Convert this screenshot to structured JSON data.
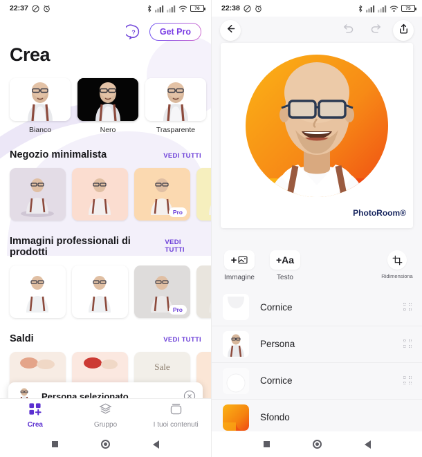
{
  "left": {
    "status": {
      "time": "22:37",
      "battery": "76",
      "icons": [
        "dnd-icon",
        "alarm-icon",
        "bluetooth-icon",
        "signal-icon",
        "signal-icon-2",
        "wifi-icon"
      ]
    },
    "top": {
      "help_label": "?",
      "get_pro_label": "Get Pro"
    },
    "title": "Crea",
    "backgrounds": [
      {
        "label": "Bianco",
        "style": "white"
      },
      {
        "label": "Nero",
        "style": "black"
      },
      {
        "label": "Trasparente",
        "style": "transparent"
      }
    ],
    "sections": [
      {
        "title": "Negozio minimalista",
        "see_all": "VEDI TUTTI",
        "tiles": [
          {
            "bg": "#e3dce6",
            "pro": false
          },
          {
            "bg": "#fbddd0",
            "pro": false
          },
          {
            "bg": "#fbd9b0",
            "pro": true,
            "pro_label": "Pro"
          },
          {
            "bg": "#f6efbe",
            "pro": false
          }
        ]
      },
      {
        "title": "Immagini professionali di prodotti",
        "see_all": "VEDI TUTTI",
        "tiles": [
          {
            "bg": "#ffffff",
            "pro": false
          },
          {
            "bg": "#ffffff",
            "pro": false
          },
          {
            "bg": "#dedcdb",
            "pro": true,
            "pro_label": "Pro"
          },
          {
            "bg": "#e9e5de",
            "pro": false
          }
        ]
      },
      {
        "title": "Saldi",
        "see_all": "VEDI TUTTI",
        "tiles": [
          {
            "bg": "#f7ece4",
            "pro": false
          },
          {
            "bg": "#fbe8e0",
            "pro": false
          },
          {
            "bg": "#f2efe9",
            "pro": false,
            "text": "Sale"
          },
          {
            "bg": "#fbe6d6",
            "pro": false
          }
        ]
      }
    ],
    "toast": {
      "text": "Persona selezionato",
      "close_icon": "close-circle-icon"
    },
    "nav": [
      {
        "label": "Crea",
        "icon": "grid-plus-icon",
        "active": true
      },
      {
        "label": "Gruppo",
        "icon": "layers-icon",
        "active": false
      },
      {
        "label": "I tuoi contenuti",
        "icon": "archive-icon",
        "active": false
      }
    ]
  },
  "right": {
    "status": {
      "time": "22:38",
      "battery": "75"
    },
    "toolbar": {
      "back_icon": "arrow-left-icon",
      "undo_icon": "undo-icon",
      "redo_icon": "redo-icon",
      "share_icon": "share-upload-icon"
    },
    "canvas": {
      "watermark": "PhotoRoom",
      "watermark_mark": "®"
    },
    "tools": [
      {
        "label": "Immagine",
        "chip": "+",
        "icon": "image-plus-icon"
      },
      {
        "label": "Testo",
        "chip": "+Aa",
        "icon": "text-plus-icon"
      },
      {
        "label": "Ridimensiona",
        "chip": "",
        "icon": "crop-resize-icon"
      }
    ],
    "layers": [
      {
        "name": "Cornice",
        "thumb": "frame",
        "draggable": true
      },
      {
        "name": "Persona",
        "thumb": "person",
        "draggable": true
      },
      {
        "name": "Cornice",
        "thumb": "frame-outline",
        "draggable": true
      },
      {
        "name": "Sfondo",
        "thumb": "orange-gradient",
        "draggable": false
      }
    ]
  },
  "colors": {
    "accent_purple": "#6c3fd8",
    "orange_start": "#f9a825",
    "orange_end": "#ef4a13",
    "watermark": "#17255e"
  }
}
